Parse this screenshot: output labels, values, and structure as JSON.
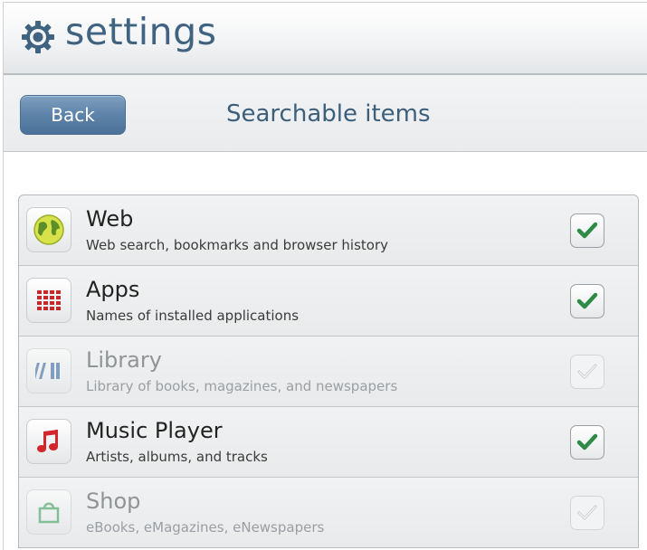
{
  "header": {
    "title": "settings",
    "icon": "gear-icon",
    "color": "#3f6380"
  },
  "nav": {
    "back_label": "Back",
    "title": "Searchable items"
  },
  "items": [
    {
      "label": "Web",
      "description": "Web search, bookmarks and browser history",
      "icon": "globe-icon",
      "checked": true,
      "enabled": true
    },
    {
      "label": "Apps",
      "description": "Names of installed applications",
      "icon": "apps-grid-icon",
      "checked": true,
      "enabled": true
    },
    {
      "label": "Library",
      "description": "Library of books, magazines, and newspapers",
      "icon": "library-icon",
      "checked": false,
      "enabled": false
    },
    {
      "label": "Music Player",
      "description": "Artists, albums, and tracks",
      "icon": "music-note-icon",
      "checked": true,
      "enabled": true
    },
    {
      "label": "Shop",
      "description": "eBooks, eMagazines, eNewspapers",
      "icon": "shopping-bag-icon",
      "checked": false,
      "enabled": false
    }
  ],
  "colors": {
    "check_green": "#2e8b45",
    "accent_blue": "#5e83a9"
  }
}
